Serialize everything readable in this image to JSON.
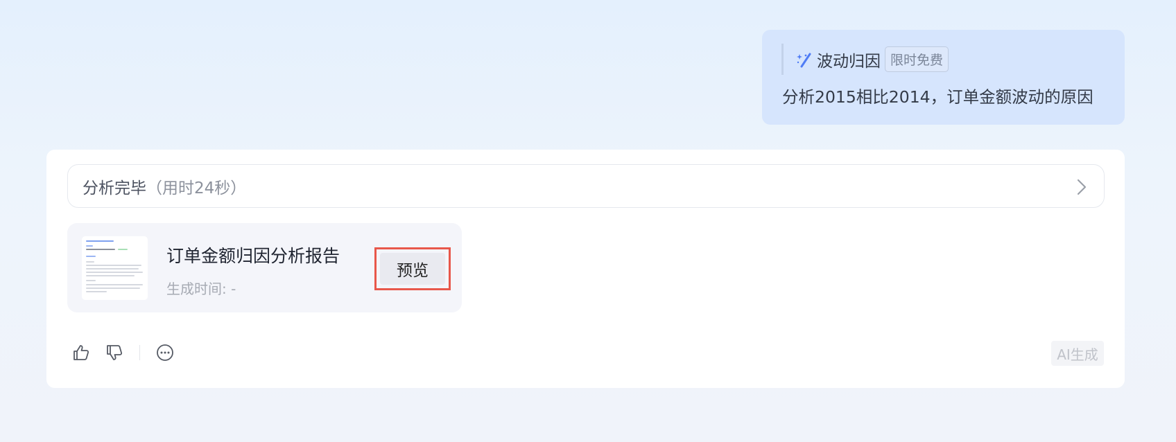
{
  "user_message": {
    "skill_icon": "magic-wand-icon",
    "skill_name": "波动归因",
    "skill_badge": "限时免费",
    "query": "分析2015相比2014，订单金额波动的原因"
  },
  "answer": {
    "status": "分析完毕",
    "status_detail": "（用时24秒）",
    "status_chevron_icon": "chevron-right-icon",
    "report": {
      "title": "订单金额归因分析报告",
      "time_label": "生成时间: -",
      "preview_label": "预览"
    },
    "actions": {
      "like_icon": "thumbs-up-icon",
      "dislike_icon": "thumbs-down-icon",
      "more_icon": "more-icon"
    },
    "ai_badge": "AI生成"
  },
  "colors": {
    "accent": "#4f7cf5",
    "highlight": "#e8574a"
  }
}
